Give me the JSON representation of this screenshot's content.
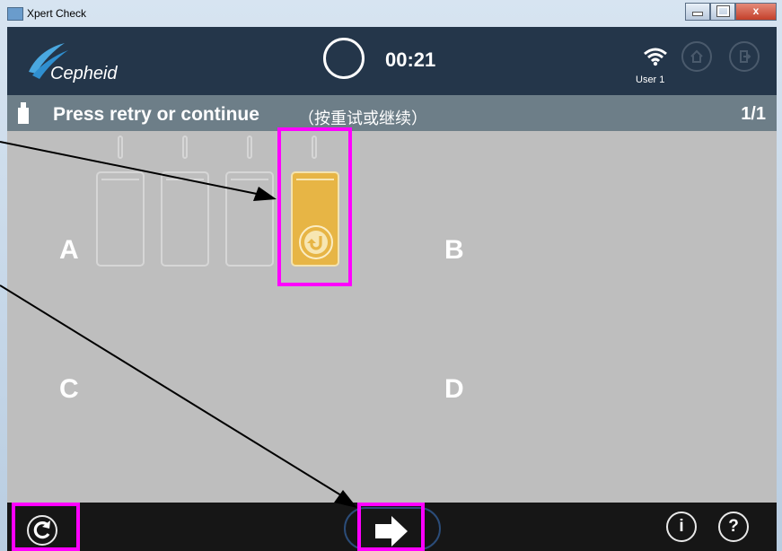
{
  "window": {
    "title": "Xpert Check",
    "close_label": "x"
  },
  "header": {
    "logo_text": "Cepheid",
    "timer": "00:21",
    "user": "User 1"
  },
  "status": {
    "title": "Press retry or continue",
    "subtitle": "（按重试或继续）",
    "page": "1/1"
  },
  "quadrants": {
    "a": "A",
    "b": "B",
    "c": "C",
    "d": "D"
  },
  "footer": {
    "info_label": "i",
    "help_label": "?"
  },
  "colors": {
    "header": "#24364a",
    "status_bar": "#6d7e88",
    "panel": "#bebebe",
    "module_active": "#e7b545",
    "highlight": "#ff00ff",
    "footer": "#161616"
  },
  "icons": {
    "app": "app-icon",
    "logo": "cepheid-logo",
    "wifi": "wifi-icon",
    "home": "home-icon",
    "logout": "logout-icon",
    "cartridge": "cartridge-icon",
    "retry": "retry-icon",
    "continue": "arrow-right-icon",
    "info": "info-icon",
    "help": "help-icon"
  }
}
